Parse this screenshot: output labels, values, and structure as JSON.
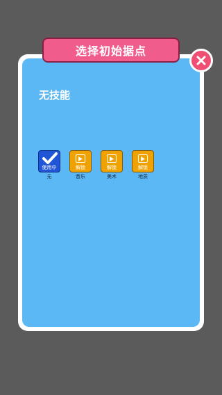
{
  "header": {
    "title": "选择初始据点"
  },
  "skill_section": {
    "current_skill": "无技能"
  },
  "skills": [
    {
      "label": "无",
      "badge": "使用中",
      "state": "active",
      "icon": "checkmark-icon"
    },
    {
      "label": "音乐",
      "badge": "解锁",
      "state": "locked",
      "icon": "video-play-icon"
    },
    {
      "label": "美术",
      "badge": "解锁",
      "state": "locked",
      "icon": "video-play-icon"
    },
    {
      "label": "地质",
      "badge": "解锁",
      "state": "locked",
      "icon": "video-play-icon"
    }
  ],
  "colors": {
    "background": "#5b5b5b",
    "panel": "#5bb8f5",
    "banner": "#f05d8d",
    "active": "#1f55d6",
    "locked": "#f0a300"
  }
}
